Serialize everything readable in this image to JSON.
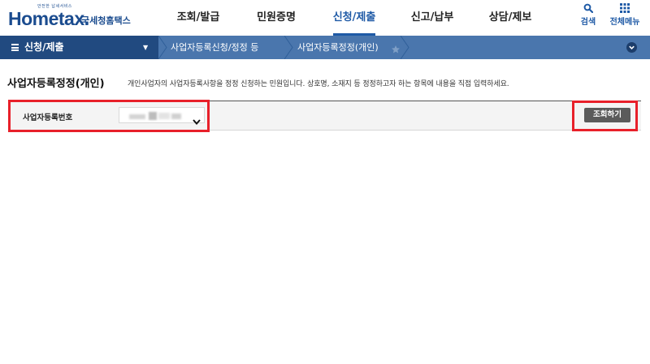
{
  "header": {
    "logo": {
      "tagline": "안전한 납세서비스",
      "wordmark": "Hometax.",
      "subtitle": "국세청홈택스"
    },
    "menu": [
      {
        "label": "조회/발급",
        "active": false
      },
      {
        "label": "민원증명",
        "active": false
      },
      {
        "label": "신청/제출",
        "active": true
      },
      {
        "label": "신고/납부",
        "active": false
      },
      {
        "label": "상담/제보",
        "active": false
      }
    ],
    "search_label": "검색",
    "all_menu_label": "전체메뉴"
  },
  "nav": {
    "current": "신청/제출",
    "breadcrumbs": [
      "사업자등록신청/정정 등",
      "사업자등록정정(개인)"
    ],
    "icons": {
      "menu": "hamburger-icon",
      "favorite": "star-icon",
      "expand": "chevron-down-icon"
    }
  },
  "page": {
    "title": "사업자등록정정(개인)",
    "description": "개인사업자의 사업자등록사항을 정정 신청하는 민원입니다. 상호명, 소재지 등 정정하고자 하는 항목에 내용을 직접 입력하세요."
  },
  "form": {
    "field_label": "사업자등록번호",
    "search_button": "조회하기"
  },
  "colors": {
    "brand": "#1b4c8f",
    "nav_bar": "#4a76ad",
    "nav_current": "#214a80",
    "highlight": "#e8202a",
    "button": "#5b5b5b"
  }
}
